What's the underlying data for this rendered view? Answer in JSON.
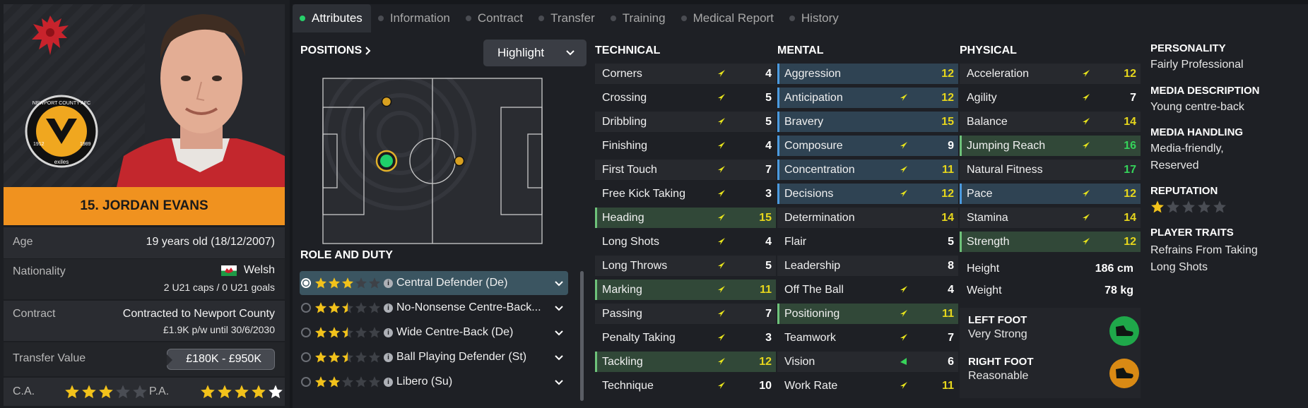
{
  "player": {
    "number_name": "15. JORDAN EVANS",
    "club_badge_text": {
      "top": "NEWPORT COUNTY AFC",
      "bottom": "exiles",
      "left_year": "1912",
      "right_year": "1989"
    }
  },
  "info": {
    "age_label": "Age",
    "age_value": "19 years old (18/12/2007)",
    "nationality_label": "Nationality",
    "nationality_value": "Welsh",
    "caps": "2 U21 caps / 0 U21 goals",
    "contract_label": "Contract",
    "contract_value": "Contracted to Newport County",
    "contract_sub": "£1.9K p/w until 30/6/2030",
    "transfer_label": "Transfer Value",
    "transfer_value": "£180K - £950K",
    "ca_label": "C.A.",
    "pa_label": "P.A.",
    "ca_stars": 3,
    "pa_stars": 4.5
  },
  "tabs": [
    {
      "label": "Attributes",
      "active": true
    },
    {
      "label": "Information"
    },
    {
      "label": "Contract"
    },
    {
      "label": "Transfer"
    },
    {
      "label": "Training"
    },
    {
      "label": "Medical Report"
    },
    {
      "label": "History"
    }
  ],
  "positions": {
    "heading": "POSITIONS",
    "highlight_label": "Highlight"
  },
  "roles": {
    "heading": "ROLE AND DUTY",
    "items": [
      {
        "name": "Central Defender (De)",
        "stars": 3,
        "selected": true
      },
      {
        "name": "No-Nonsense Centre-Back...",
        "stars": 2.5
      },
      {
        "name": "Wide Centre-Back (De)",
        "stars": 2.5
      },
      {
        "name": "Ball Playing Defender (St)",
        "stars": 2.5
      },
      {
        "name": "Libero (Su)",
        "stars": 2
      }
    ]
  },
  "technical": {
    "heading": "TECHNICAL",
    "items": [
      {
        "name": "Corners",
        "value": "4"
      },
      {
        "name": "Crossing",
        "value": "5"
      },
      {
        "name": "Dribbling",
        "value": "5"
      },
      {
        "name": "Finishing",
        "value": "4"
      },
      {
        "name": "First Touch",
        "value": "7"
      },
      {
        "name": "Free Kick Taking",
        "value": "3"
      },
      {
        "name": "Heading",
        "value": "15",
        "hl": "green",
        "color": "y"
      },
      {
        "name": "Long Shots",
        "value": "4"
      },
      {
        "name": "Long Throws",
        "value": "5"
      },
      {
        "name": "Marking",
        "value": "11",
        "hl": "green",
        "color": "y"
      },
      {
        "name": "Passing",
        "value": "7"
      },
      {
        "name": "Penalty Taking",
        "value": "3"
      },
      {
        "name": "Tackling",
        "value": "12",
        "hl": "green",
        "color": "y"
      },
      {
        "name": "Technique",
        "value": "10"
      }
    ]
  },
  "mental": {
    "heading": "MENTAL",
    "items": [
      {
        "name": "Aggression",
        "value": "12",
        "hl": "blue",
        "color": "y",
        "arrow": false
      },
      {
        "name": "Anticipation",
        "value": "12",
        "hl": "blue",
        "color": "y"
      },
      {
        "name": "Bravery",
        "value": "15",
        "hl": "blue",
        "color": "y",
        "arrow": false
      },
      {
        "name": "Composure",
        "value": "9",
        "hl": "blue"
      },
      {
        "name": "Concentration",
        "value": "11",
        "hl": "blue",
        "color": "y"
      },
      {
        "name": "Decisions",
        "value": "12",
        "hl": "blue",
        "color": "y"
      },
      {
        "name": "Determination",
        "value": "14",
        "color": "y",
        "arrow": false
      },
      {
        "name": "Flair",
        "value": "5",
        "arrow": false
      },
      {
        "name": "Leadership",
        "value": "8",
        "arrow": false
      },
      {
        "name": "Off The Ball",
        "value": "4"
      },
      {
        "name": "Positioning",
        "value": "11",
        "hl": "green",
        "color": "y"
      },
      {
        "name": "Teamwork",
        "value": "7"
      },
      {
        "name": "Vision",
        "value": "6",
        "arrow_green": true
      },
      {
        "name": "Work Rate",
        "value": "11",
        "color": "y"
      }
    ]
  },
  "physical": {
    "heading": "PHYSICAL",
    "items": [
      {
        "name": "Acceleration",
        "value": "12",
        "color": "y"
      },
      {
        "name": "Agility",
        "value": "7"
      },
      {
        "name": "Balance",
        "value": "14",
        "color": "y"
      },
      {
        "name": "Jumping Reach",
        "value": "16",
        "hl": "green",
        "color": "g"
      },
      {
        "name": "Natural Fitness",
        "value": "17",
        "color": "g",
        "arrow": false
      },
      {
        "name": "Pace",
        "value": "12",
        "hl": "blue",
        "color": "y"
      },
      {
        "name": "Stamina",
        "value": "14",
        "color": "y"
      },
      {
        "name": "Strength",
        "value": "12",
        "hl": "green",
        "color": "y"
      }
    ],
    "height_label": "Height",
    "height_value": "186 cm",
    "weight_label": "Weight",
    "weight_value": "78 kg",
    "left_foot_label": "LEFT FOOT",
    "left_foot_value": "Very Strong",
    "right_foot_label": "RIGHT FOOT",
    "right_foot_value": "Reasonable",
    "colors": {
      "left_foot": "#1fa84a",
      "right_foot": "#d98a14"
    }
  },
  "side": {
    "personality_head": "PERSONALITY",
    "personality_value": "Fairly Professional",
    "media_desc_head": "MEDIA DESCRIPTION",
    "media_desc_value": "Young centre-back",
    "media_handling_head": "MEDIA HANDLING",
    "media_handling_value_1": "Media-friendly,",
    "media_handling_value_2": "Reserved",
    "reputation_head": "REPUTATION",
    "reputation_stars": 1,
    "traits_head": "PLAYER TRAITS",
    "traits_value_1": "Refrains From Taking",
    "traits_value_2": "Long Shots"
  },
  "colors": {
    "accent_orange": "#f0921f",
    "star_gold": "#f2c21b",
    "value_yellow": "#e6d61c",
    "value_green": "#35d35a"
  }
}
